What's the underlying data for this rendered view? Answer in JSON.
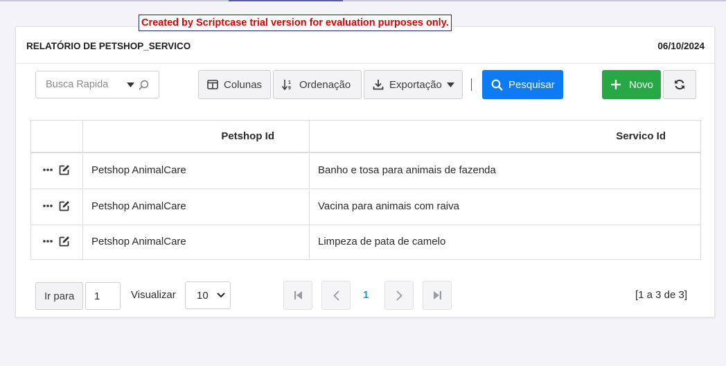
{
  "trial_banner": "Created by Scriptcase trial version for evaluation purposes only.",
  "header": {
    "title": "RELATÓRIO DE PETSHOP_SERVICO",
    "date": "06/10/2024"
  },
  "toolbar": {
    "search_placeholder": "Busca Rapida",
    "colunas_label": "Colunas",
    "ordenacao_label": "Ordenação",
    "exportacao_label": "Exportação",
    "pesquisar_label": "Pesquisar",
    "novo_label": "Novo"
  },
  "grid": {
    "columns": [
      "Petshop Id",
      "Servico Id"
    ],
    "rows": [
      {
        "petshop": "Petshop AnimalCare",
        "servico": "Banho e tosa para animais de fazenda"
      },
      {
        "petshop": "Petshop AnimalCare",
        "servico": "Vacina para animais com raiva"
      },
      {
        "petshop": "Petshop AnimalCare",
        "servico": "Limpeza de pata de camelo"
      }
    ]
  },
  "pager": {
    "goto_label": "Ir para",
    "goto_value": "1",
    "view_label": "Visualizar",
    "per_page": "10",
    "current_page": "1",
    "range_text": "[1 a 3 de 3]"
  },
  "colors": {
    "primary": "#0d7cf2",
    "success": "#28a745",
    "trial_text": "#e00000",
    "page_link": "#2196c9"
  },
  "icons": {
    "search": "magnifier-icon",
    "columns": "columns-icon",
    "sort": "sort-icon",
    "export": "download-icon",
    "add": "plus-icon",
    "refresh": "refresh-icon",
    "row_menu": "ellipsis-icon",
    "row_edit": "edit-icon"
  }
}
